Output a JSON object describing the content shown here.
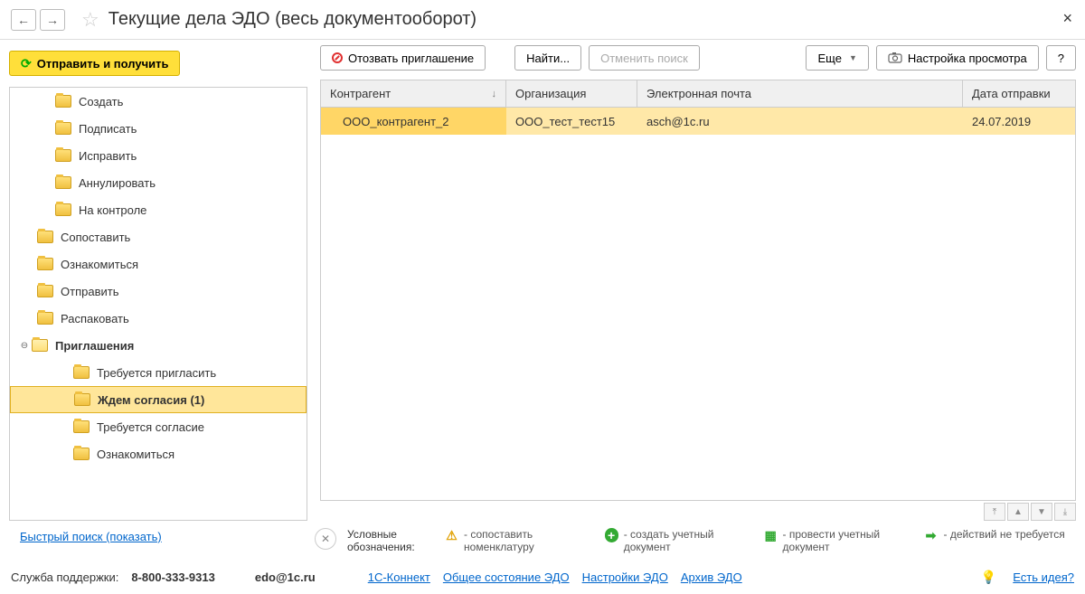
{
  "title": "Текущие дела ЭДО (весь документооборот)",
  "nav": {
    "back": "←",
    "forward": "→"
  },
  "toolbar": {
    "send_receive": "Отправить и получить",
    "revoke": "Отозвать приглашение",
    "find": "Найти...",
    "cancel_search": "Отменить поиск",
    "more": "Еще",
    "view_settings": "Настройка просмотра",
    "help": "?"
  },
  "tree": {
    "items": [
      {
        "label": "Создать",
        "indent": "indent-1"
      },
      {
        "label": "Подписать",
        "indent": "indent-1"
      },
      {
        "label": "Исправить",
        "indent": "indent-1"
      },
      {
        "label": "Аннулировать",
        "indent": "indent-1"
      },
      {
        "label": "На контроле",
        "indent": "indent-1"
      },
      {
        "label": "Сопоставить",
        "indent": "indent-0b"
      },
      {
        "label": "Ознакомиться",
        "indent": "indent-0b"
      },
      {
        "label": "Отправить",
        "indent": "indent-0b"
      },
      {
        "label": "Распаковать",
        "indent": "indent-0b"
      },
      {
        "label": "Приглашения",
        "indent": "",
        "expandable": true,
        "open": true,
        "bold": true
      },
      {
        "label": "Требуется пригласить",
        "indent": "indent-2"
      },
      {
        "label": "Ждем согласия (1)",
        "indent": "indent-2",
        "selected": true,
        "bold": true
      },
      {
        "label": "Требуется согласие",
        "indent": "indent-2"
      },
      {
        "label": "Ознакомиться",
        "indent": "indent-2"
      }
    ]
  },
  "grid": {
    "headers": {
      "counterparty": "Контрагент",
      "org": "Организация",
      "email": "Электронная почта",
      "date": "Дата отправки"
    },
    "rows": [
      {
        "counterparty": "ООО_контрагент_2",
        "org": "ООО_тест_тест15",
        "email": "asch@1c.ru",
        "date": "24.07.2019"
      }
    ]
  },
  "legend": {
    "label": "Условные обозначения:",
    "items": [
      {
        "icon": "warn",
        "text": "- сопоставить номенклатуру"
      },
      {
        "icon": "plus",
        "text": "- создать учетный документ"
      },
      {
        "icon": "doc",
        "text": "- провести учетный документ"
      },
      {
        "icon": "arrow",
        "text": "- действий не требуется"
      }
    ]
  },
  "quick_search": "Быстрый поиск (показать)",
  "footer": {
    "support_label": "Служба поддержки:",
    "phone": "8-800-333-9313",
    "email": "edo@1c.ru",
    "links": {
      "connect": "1С-Коннект",
      "status": "Общее состояние ЭДО",
      "settings": "Настройки ЭДО",
      "archive": "Архив ЭДО"
    },
    "idea": "Есть идея?"
  }
}
